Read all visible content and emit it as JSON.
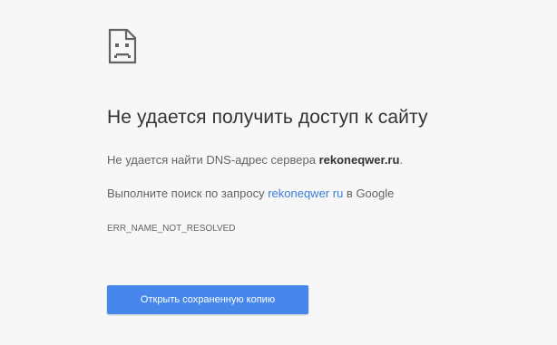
{
  "error_page": {
    "icon": "sad-page-icon",
    "title": "Не удается получить доступ к сайту",
    "dns_message_before": "Не удается найти DNS-адрес сервера ",
    "host": "rekoneqwer.ru",
    "dns_message_after": ".",
    "search_before": "Выполните поиск по запросу ",
    "search_query": "rekoneqwer ru",
    "search_after": " в Google",
    "error_code": "ERR_NAME_NOT_RESOLVED",
    "button_label": "Открыть сохраненную копию"
  },
  "colors": {
    "background": "#f7f7f7",
    "title": "#333333",
    "text": "#646464",
    "link": "#3b7ddb",
    "button": "#4787ec"
  }
}
